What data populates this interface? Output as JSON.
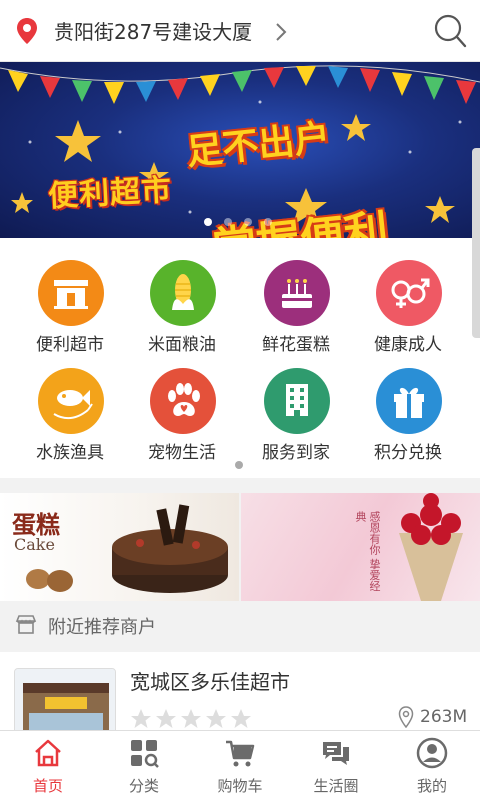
{
  "header": {
    "location": "贵阳街287号建设大厦"
  },
  "banner": {
    "line_top": "足不出户",
    "line_left": "便利超市",
    "line_main": "掌握便利",
    "active_index": 0,
    "page_count": 4
  },
  "categories": [
    {
      "label": "便利超市",
      "icon": "store-icon",
      "color": "#f38a16"
    },
    {
      "label": "米面粮油",
      "icon": "corn-icon",
      "color": "#58b32b"
    },
    {
      "label": "鲜花蛋糕",
      "icon": "cake-icon",
      "color": "#9c2f7c"
    },
    {
      "label": "健康成人",
      "icon": "gender-icon",
      "color": "#ef5964"
    },
    {
      "label": "水族渔具",
      "icon": "fish-icon",
      "color": "#f3a31a"
    },
    {
      "label": "宠物生活",
      "icon": "paw-icon",
      "color": "#e4513a"
    },
    {
      "label": "服务到家",
      "icon": "building-icon",
      "color": "#2f9b6e"
    },
    {
      "label": "积分兑换",
      "icon": "gift-icon",
      "color": "#2a8fd6"
    }
  ],
  "promos": {
    "cake_title": "蛋糕",
    "cake_sub": "Cake",
    "flower_text": "感恩有你 挚爱经典"
  },
  "section": {
    "title": "附近推荐商户"
  },
  "merchant": {
    "name": "宽城区多乐佳超市",
    "rating": 0,
    "rating_max": 5,
    "distance": "263M"
  },
  "tabs": [
    {
      "label": "首页",
      "icon": "home-icon",
      "active": true
    },
    {
      "label": "分类",
      "icon": "category-icon",
      "active": false
    },
    {
      "label": "购物车",
      "icon": "cart-icon",
      "active": false
    },
    {
      "label": "生活圈",
      "icon": "chat-icon",
      "active": false
    },
    {
      "label": "我的",
      "icon": "profile-icon",
      "active": false
    }
  ],
  "colors": {
    "accent": "#e8383d",
    "star_empty": "#dddddd"
  }
}
